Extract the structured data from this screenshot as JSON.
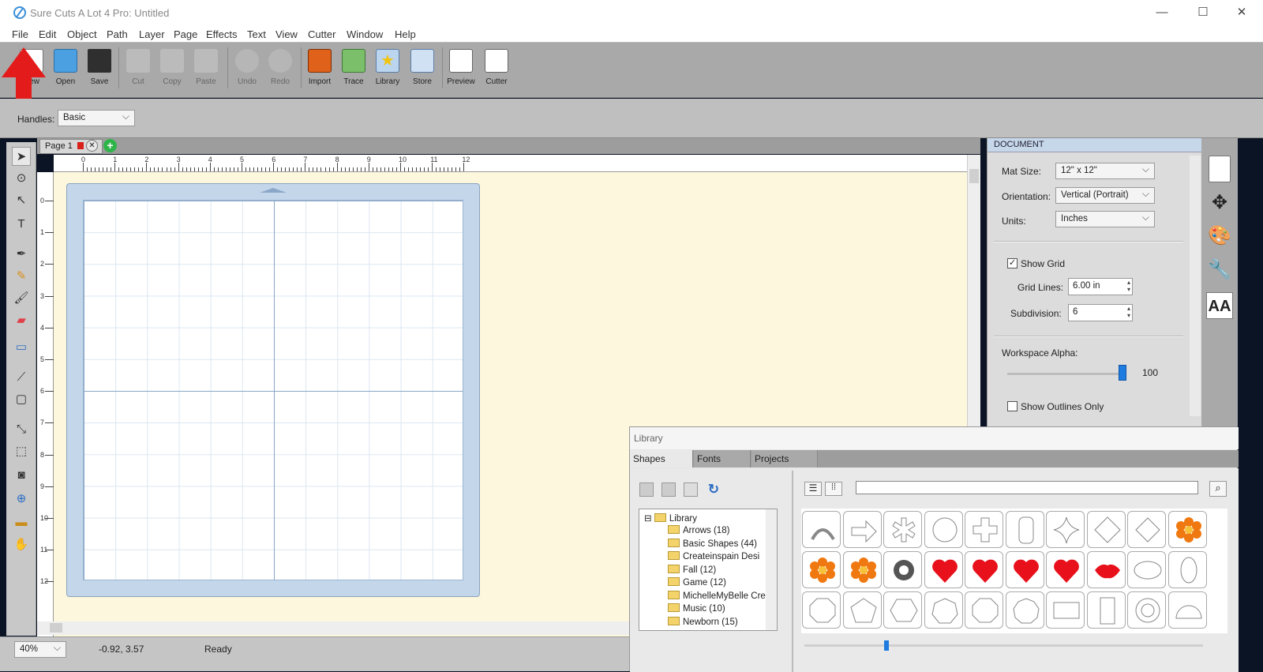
{
  "window": {
    "title": "Sure Cuts A Lot 4 Pro: Untitled",
    "minimize": "—",
    "maximize": "☐",
    "close": "✕"
  },
  "menu": [
    "File",
    "Edit",
    "Object",
    "Path",
    "Layer",
    "Page",
    "Effects",
    "Text",
    "View",
    "Cutter",
    "Window",
    "Help"
  ],
  "toolbar": [
    {
      "label": "New",
      "icon": "new-file-icon",
      "enabled": true
    },
    {
      "label": "Open",
      "icon": "open-folder-icon",
      "enabled": true
    },
    {
      "label": "Save",
      "icon": "floppy-disk-icon",
      "enabled": true
    },
    {
      "label": "Cut",
      "icon": "scissors-icon",
      "enabled": false
    },
    {
      "label": "Copy",
      "icon": "copy-icon",
      "enabled": false
    },
    {
      "label": "Paste",
      "icon": "paste-icon",
      "enabled": false
    },
    {
      "label": "Undo",
      "icon": "undo-icon",
      "enabled": false
    },
    {
      "label": "Redo",
      "icon": "redo-icon",
      "enabled": false
    },
    {
      "label": "Import",
      "icon": "import-svg-icon",
      "enabled": true
    },
    {
      "label": "Trace",
      "icon": "trace-icon",
      "enabled": true
    },
    {
      "label": "Library",
      "icon": "library-star-icon",
      "enabled": true
    },
    {
      "label": "Store",
      "icon": "store-cart-icon",
      "enabled": true
    },
    {
      "label": "Preview",
      "icon": "preview-magnifier-icon",
      "enabled": true
    },
    {
      "label": "Cutter",
      "icon": "cutter-blade-icon",
      "enabled": true
    }
  ],
  "handles": {
    "label": "Handles:",
    "value": "Basic"
  },
  "page_tab": {
    "label": "Page 1"
  },
  "ruler": {
    "top": [
      "0",
      "1",
      "2",
      "3",
      "4",
      "5",
      "6",
      "7",
      "8",
      "9",
      "10",
      "11",
      "12"
    ],
    "left": [
      "0",
      "1",
      "2",
      "3",
      "4",
      "5",
      "6",
      "7",
      "8",
      "9",
      "10",
      "11",
      "12"
    ]
  },
  "status": {
    "zoom": "40%",
    "coords": "-0.92, 3.57",
    "state": "Ready"
  },
  "document": {
    "header": "DOCUMENT",
    "mat_size_label": "Mat Size:",
    "mat_size": "12\" x 12\"",
    "orientation_label": "Orientation:",
    "orientation": "Vertical (Portrait)",
    "units_label": "Units:",
    "units": "Inches",
    "show_grid_label": "Show Grid",
    "show_grid": true,
    "grid_lines_label": "Grid Lines:",
    "grid_lines": "6.00 in",
    "subdivision_label": "Subdivision:",
    "subdivision": "6",
    "alpha_label": "Workspace Alpha:",
    "alpha": "100",
    "outlines_label": "Show Outlines Only",
    "outlines": false
  },
  "right_strip": [
    "page-icon",
    "move-arrows-icon",
    "palette-icon",
    "wrench-icon",
    "text-style-icon"
  ],
  "library": {
    "title": "Library",
    "tabs": [
      "Shapes",
      "Fonts",
      "Projects"
    ],
    "tree_root": "Library",
    "tree": [
      "Arrows (18)",
      "Basic Shapes (44)",
      "Createinspain Desi",
      "Fall (12)",
      "Game (12)",
      "MichelleMyBelle Cre",
      "Music (10)",
      "Newborn (15)"
    ],
    "shapes": [
      "arch",
      "arrow",
      "asterisk",
      "circle",
      "cross",
      "rounded-rect",
      "star4",
      "diamond",
      "diamond2",
      "flower-orange",
      "flower-orange",
      "flower-orange",
      "gear",
      "heart",
      "heart",
      "heart",
      "heart",
      "lips",
      "ellipse-h",
      "ellipse-v",
      "octagon",
      "pentagon",
      "hexagon",
      "heptagon",
      "octagon",
      "nonagon",
      "rect-h",
      "rect-v",
      "ring",
      "half-circle"
    ],
    "colors": {
      "flower": "#f07810",
      "heart": "#e8101a",
      "gear": "#555555"
    }
  }
}
